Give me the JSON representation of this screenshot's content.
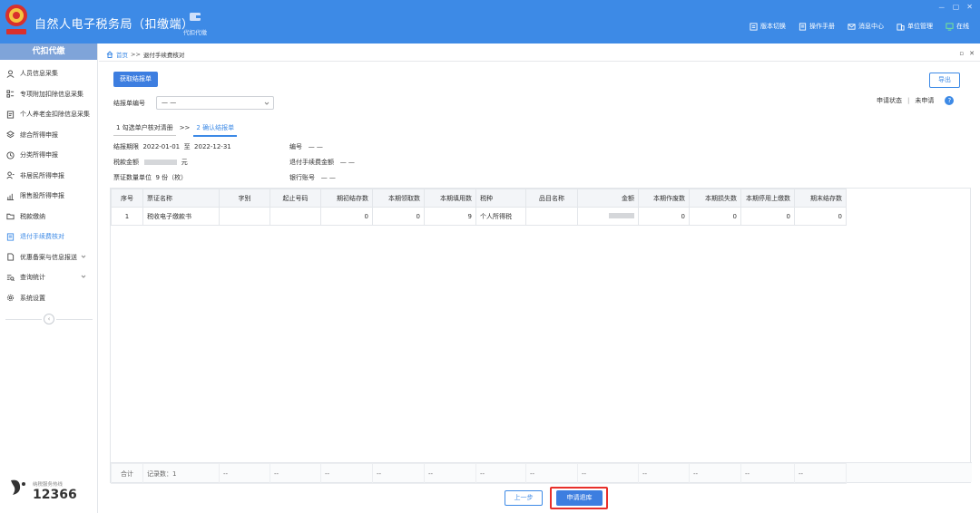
{
  "header": {
    "app_title": "自然人电子税务局（扣缴端）",
    "module_label": "代扣代缴",
    "actions": [
      {
        "label": "版本切换",
        "icon": "version-switch-icon"
      },
      {
        "label": "操作手册",
        "icon": "manual-icon"
      },
      {
        "label": "消息中心",
        "icon": "message-icon"
      },
      {
        "label": "单位管理",
        "icon": "unit-manage-icon"
      },
      {
        "label": "在线",
        "icon": "online-icon"
      }
    ],
    "window_controls": [
      "－",
      "▢",
      "✕"
    ]
  },
  "sidebar": {
    "title": "代扣代缴",
    "items": [
      {
        "label": "人员信息采集",
        "icon": "person-icon"
      },
      {
        "label": "专项附加扣除信息采集",
        "icon": "list-icon"
      },
      {
        "label": "个人养老金扣除信息采集",
        "icon": "document-icon"
      },
      {
        "label": "综合所得申报",
        "icon": "layers-icon"
      },
      {
        "label": "分类所得申报",
        "icon": "clock-icon"
      },
      {
        "label": "非居民所得申报",
        "icon": "user-outline-icon"
      },
      {
        "label": "限售股所得申报",
        "icon": "bar-chart-icon"
      },
      {
        "label": "税款缴纳",
        "icon": "folder-icon"
      },
      {
        "label": "退付手续费核对",
        "icon": "receipt-icon"
      },
      {
        "label": "优惠备案与信息报送",
        "icon": "file-icon"
      },
      {
        "label": "查询统计",
        "icon": "search-list-icon"
      },
      {
        "label": "系统设置",
        "icon": "gear-icon"
      }
    ],
    "active_index": 8,
    "hotline_label": "纳税服务热线",
    "hotline_number": "12366"
  },
  "breadcrumb": {
    "home": "首页",
    "sep": ">>",
    "current": "退付手续费核对",
    "controls": [
      "▫",
      "✕"
    ]
  },
  "toolbar": {
    "get_button": "获取结报单",
    "export_button": "导出"
  },
  "form": {
    "report_no_label": "结报单编号",
    "report_no_value": "— —",
    "status_label": "申请状态",
    "status_divider": "|",
    "status_value": "未申请",
    "help_icon": "?"
  },
  "steps": {
    "step1": "1 勾选单户核对清册",
    "sep": ">>",
    "step2": "2 确认结报单"
  },
  "info": {
    "period_label": "结报期限",
    "period_from": "2022-01-01",
    "period_to_word": "至",
    "period_to": "2022-12-31",
    "tax_amount_label": "税款金额",
    "tax_amount_unit": "元",
    "count_label": "票证数量单位",
    "count_value": "9 份（枚）",
    "code_label": "编号",
    "code_value": "— —",
    "refund_label": "退付手续费金额",
    "refund_value": "— —",
    "bank_label": "银行账号",
    "bank_value": "— —"
  },
  "table": {
    "columns": [
      "序号",
      "票证名称",
      "字别",
      "起止号码",
      "期初结存数",
      "本期领取数",
      "本期填用数",
      "税种",
      "品目名称",
      "金额",
      "本期作废数",
      "本期损失数",
      "本期停用上缴数",
      "期末结存数"
    ],
    "rows": [
      [
        "1",
        "税收电子缴款书",
        "",
        "",
        "0",
        "0",
        "9",
        "个人所得税",
        "",
        "",
        "0",
        "0",
        "0",
        "0"
      ]
    ],
    "footer": {
      "total_label": "合计",
      "record_label": "记录数：1",
      "placeholder": "--"
    }
  },
  "bottom": {
    "prev_button": "上一步",
    "apply_button": "申请退库"
  },
  "colors": {
    "primary": "#3d8ae6",
    "highlight": "#e8302b"
  }
}
